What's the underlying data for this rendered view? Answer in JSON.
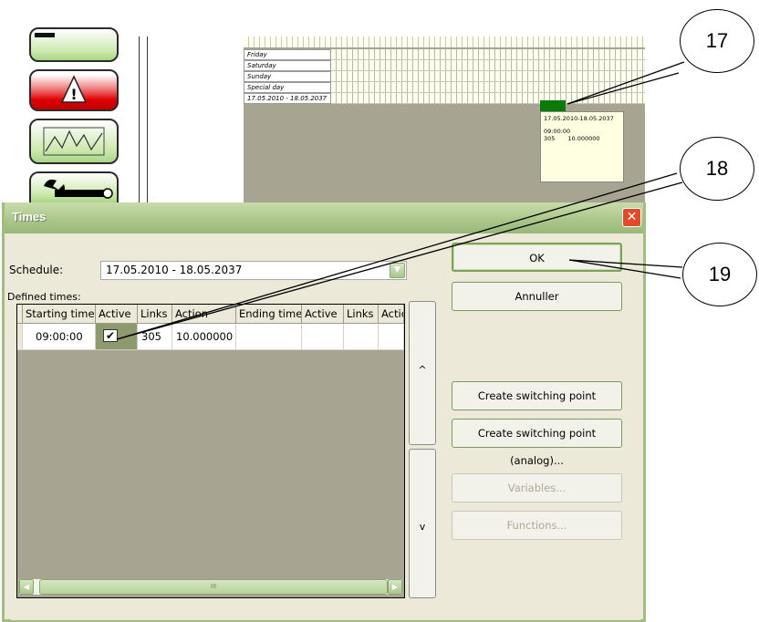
{
  "schedule_view": {
    "rows": [
      "Friday",
      "Saturday",
      "Sunday",
      "Special day",
      "17.05.2010 - 18.05.2037"
    ],
    "tooltip": {
      "range": "17.05.2010-18.05.2037",
      "time": "09:00:00",
      "links": "305",
      "value": "10.000000"
    }
  },
  "callouts": [
    "17",
    "18",
    "19"
  ],
  "dialog": {
    "title": "Times",
    "schedule_label": "Schedule:",
    "schedule_value": "17.05.2010 - 18.05.2037",
    "defined_times_label": "Defined times:",
    "columns": [
      "Starting time",
      "Active",
      "Links",
      "Action",
      "Ending time",
      "Active",
      "Links",
      "Actic"
    ],
    "rows": [
      {
        "start": "09:00:00",
        "active": true,
        "links": "305",
        "action": "10.000000",
        "end": "",
        "active2": "",
        "links2": "",
        "action2": ""
      }
    ],
    "scroll_up": "^",
    "scroll_down": "v",
    "buttons": {
      "ok": "OK",
      "cancel": "Annuller",
      "switch_onoff": "Create switching point (on/off)...",
      "switch_analog": "Create switching point (analog)...",
      "variables": "Variables...",
      "functions": "Functions..."
    }
  },
  "colors": {
    "title_bar": "#aec98e",
    "schedule_bg": "#a8a492",
    "marker": "#0a7a0a",
    "close": "#e14a2a"
  }
}
